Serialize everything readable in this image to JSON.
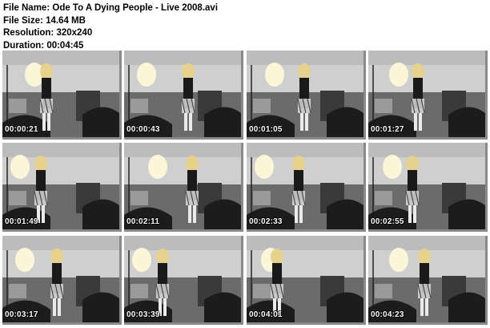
{
  "file_info": {
    "file_name_label": "File Name:",
    "file_name": "Ode To A Dying People - Live 2008.avi",
    "file_size_label": "File Size:",
    "file_size": "14.64 MB",
    "resolution_label": "Resolution:",
    "resolution": "320x240",
    "duration_label": "Duration:",
    "duration": "00:04:45"
  },
  "thumbnails": [
    {
      "timestamp": "00:00:21"
    },
    {
      "timestamp": "00:00:43"
    },
    {
      "timestamp": "00:01:05"
    },
    {
      "timestamp": "00:01:27"
    },
    {
      "timestamp": "00:01:49"
    },
    {
      "timestamp": "00:02:11"
    },
    {
      "timestamp": "00:02:33"
    },
    {
      "timestamp": "00:02:55"
    },
    {
      "timestamp": "00:03:17"
    },
    {
      "timestamp": "00:03:39"
    },
    {
      "timestamp": "00:04:01"
    },
    {
      "timestamp": "00:04:23"
    }
  ],
  "colors": {
    "wall": "#cfcfcf",
    "shadow": "#8a8a8a",
    "stage": "#6b6b6b",
    "crowd": "#1c1c1c",
    "singer_hair": "#e6d28a",
    "singer_top": "#1a1a1a",
    "light": "#fbf6d8"
  }
}
